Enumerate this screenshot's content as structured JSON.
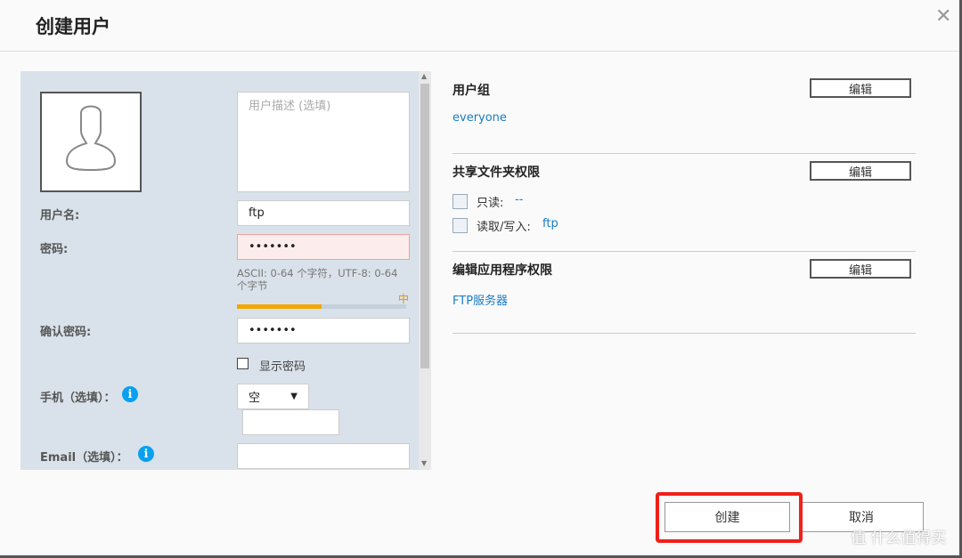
{
  "dialog": {
    "title": "创建用户",
    "close_icon": "close-icon"
  },
  "form": {
    "description_placeholder": "用户描述 (选填)",
    "username_label": "用户名:",
    "username_value": "ftp",
    "password_label": "密码:",
    "password_value": "•••••••",
    "password_hint": "ASCII: 0-64 个字符，UTF-8: 0-64 个字节",
    "strength_label": "中",
    "strength_percent": 50,
    "strength_color": "#f5a500",
    "confirm_label": "确认密码:",
    "confirm_value": "•••••••",
    "show_password_label": "显示密码",
    "show_password_checked": false,
    "phone_label": "手机（选填）：",
    "phone_country_value": "空",
    "phone_value": "",
    "email_label": "Email（选填）：",
    "email_value": ""
  },
  "right": {
    "user_group": {
      "title": "用户组",
      "edit": "编辑",
      "value": "everyone"
    },
    "share": {
      "title": "共享文件夹权限",
      "edit": "编辑",
      "readonly_label": "只读:",
      "readonly_value": "--",
      "readwrite_label": "读取/写入:",
      "readwrite_value": "ftp"
    },
    "apps": {
      "title": "编辑应用程序权限",
      "edit": "编辑",
      "value": "FTP服务器"
    }
  },
  "footer": {
    "create": "创建",
    "cancel": "取消",
    "highlight_color": "#f0201a"
  },
  "watermark": "值 什么值得买"
}
